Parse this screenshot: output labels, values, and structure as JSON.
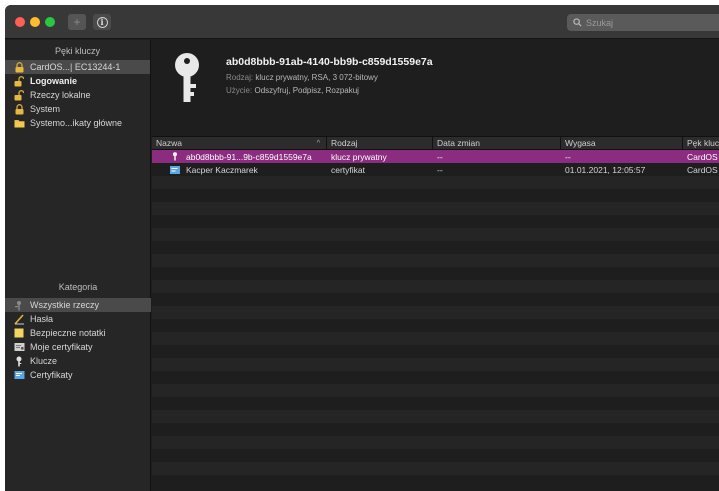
{
  "toolbar": {
    "add_label": "+",
    "search_placeholder": "Szukaj"
  },
  "sidebar": {
    "keychains_title": "Pęki kluczy",
    "keychains": [
      {
        "label": "CardOS...| EC13244-1",
        "icon": "lock-icon",
        "selected": true
      },
      {
        "label": "Logowanie",
        "icon": "unlocked-icon",
        "bold": true
      },
      {
        "label": "Rzeczy lokalne",
        "icon": "unlocked-icon"
      },
      {
        "label": "System",
        "icon": "lock-icon"
      },
      {
        "label": "Systemo...ikaty główne",
        "icon": "folder-icon"
      }
    ],
    "categories_title": "Kategoria",
    "categories": [
      {
        "label": "Wszystkie rzeczy",
        "icon": "all-items-icon",
        "selected": true
      },
      {
        "label": "Hasła",
        "icon": "password-icon"
      },
      {
        "label": "Bezpieczne notatki",
        "icon": "note-icon"
      },
      {
        "label": "Moje certyfikaty",
        "icon": "my-certificate-icon"
      },
      {
        "label": "Klucze",
        "icon": "key-icon"
      },
      {
        "label": "Certyfikaty",
        "icon": "certificate-icon"
      }
    ]
  },
  "detail": {
    "title": "ab0d8bbb-91ab-4140-bb9b-c859d1559e7a",
    "kind_label": "Rodzaj:",
    "kind_value": "klucz prywatny, RSA, 3 072-bitowy",
    "usage_label": "Użycie:",
    "usage_value": "Odszyfruj, Podpisz, Rozpakuj"
  },
  "table": {
    "columns": [
      "Nazwa",
      "Rodzaj",
      "Data zmian",
      "Wygasa",
      "Pęk klucz"
    ],
    "rows": [
      {
        "name": "ab0d8bbb-91...9b-c859d1559e7a",
        "kind": "klucz prywatny",
        "modified": "--",
        "expires": "--",
        "keychain": "CardOS",
        "icon": "key-icon",
        "selected": true
      },
      {
        "name": "Kacper Kaczmarek",
        "kind": "certyfikat",
        "modified": "--",
        "expires": "01.01.2021, 12:05:57",
        "keychain": "CardOS",
        "icon": "certificate-icon",
        "selected": false
      }
    ]
  },
  "colors": {
    "selection": "#8b2c80",
    "window_bg": "#1e1e1e",
    "sidebar_bg": "#262626"
  }
}
